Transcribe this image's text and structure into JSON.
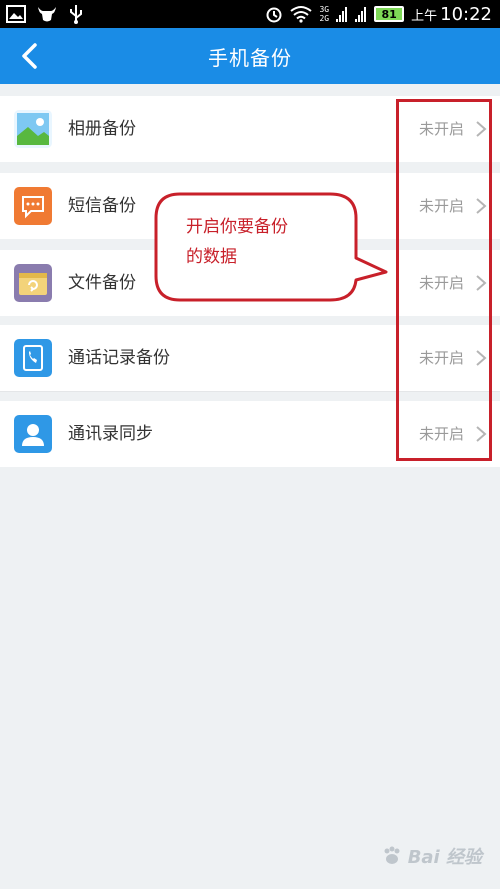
{
  "status_bar": {
    "net_top": "3G",
    "net_bottom": "2G",
    "battery": "81",
    "time_prefix": "上午",
    "time": "10:22"
  },
  "header": {
    "title": "手机备份"
  },
  "items": [
    {
      "label": "相册备份",
      "status": "未开启",
      "icon": "photo-album-icon",
      "color": "#58b83f"
    },
    {
      "label": "短信备份",
      "status": "未开启",
      "icon": "sms-icon",
      "color": "#f07a33"
    },
    {
      "label": "文件备份",
      "status": "未开启",
      "icon": "folder-icon",
      "color": "#e8c562"
    },
    {
      "label": "通话记录备份",
      "status": "未开启",
      "icon": "call-log-icon",
      "color": "#2f98e6"
    },
    {
      "label": "通讯录同步",
      "status": "未开启",
      "icon": "contacts-icon",
      "color": "#2f98e6"
    }
  ],
  "annotation": {
    "line1": "开启你要备份",
    "line2": "的数据",
    "color": "#c8202a"
  },
  "watermark": {
    "text": "Bai 经验"
  }
}
